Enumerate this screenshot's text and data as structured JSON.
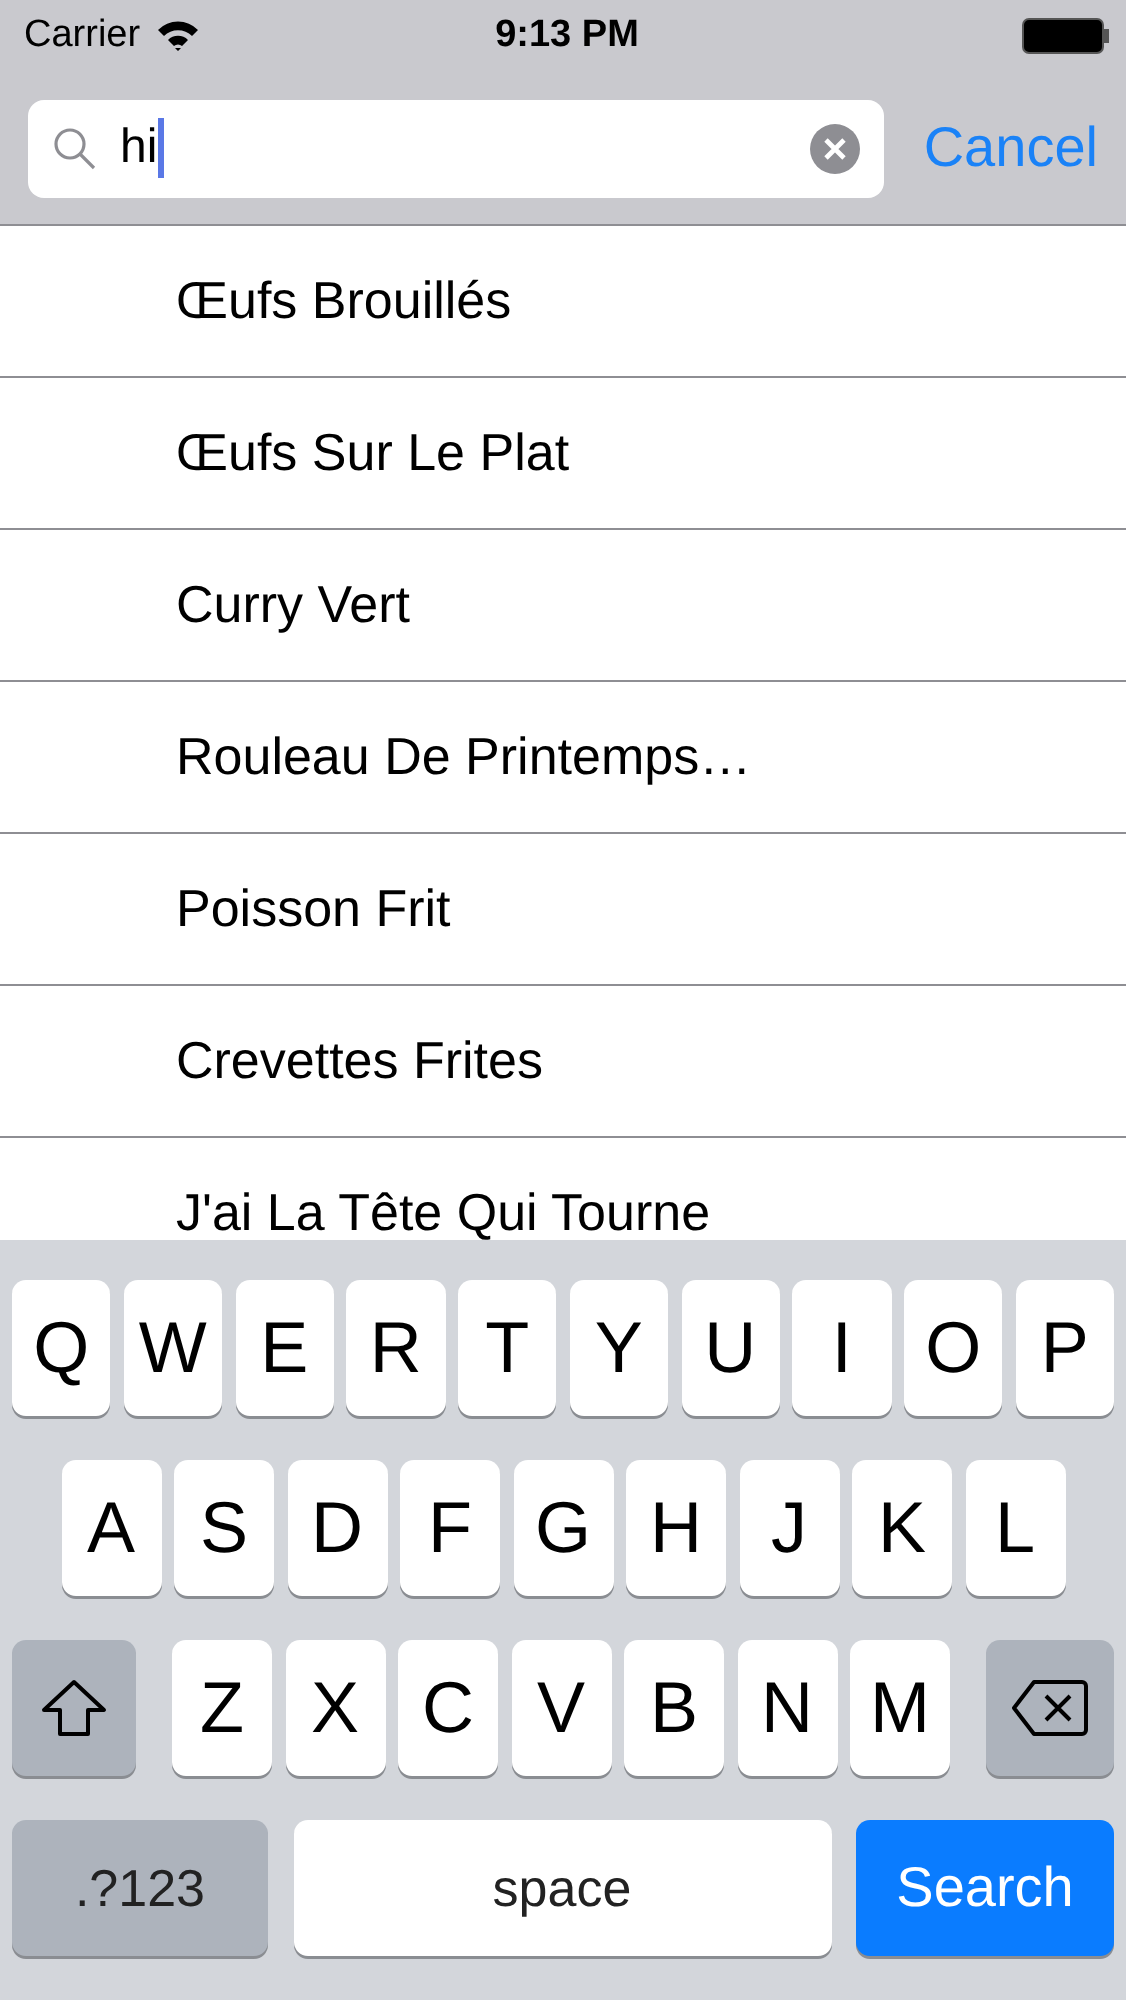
{
  "status_bar": {
    "carrier": "Carrier",
    "time": "9:13 PM"
  },
  "search": {
    "value": "hi",
    "cancel": "Cancel"
  },
  "results": [
    "Œufs Brouillés",
    "Œufs Sur Le Plat",
    "Curry Vert",
    "Rouleau De Printemps…",
    "Poisson Frit",
    "Crevettes Frites",
    "J'ai La Tête Qui Tourne"
  ],
  "keyboard": {
    "top_letters": [
      "Q",
      "W",
      "E",
      "R",
      "T",
      "Y",
      "U",
      "I",
      "O",
      "P"
    ],
    "middle_letters": [
      "A",
      "S",
      "D",
      "F",
      "G",
      "H",
      "J",
      "K",
      "L"
    ],
    "bottom_letters": [
      "Z",
      "X",
      "C",
      "V",
      "B",
      "N",
      "M"
    ],
    "numbers_key": ".?123",
    "space_key": "space",
    "search_key": "Search"
  }
}
